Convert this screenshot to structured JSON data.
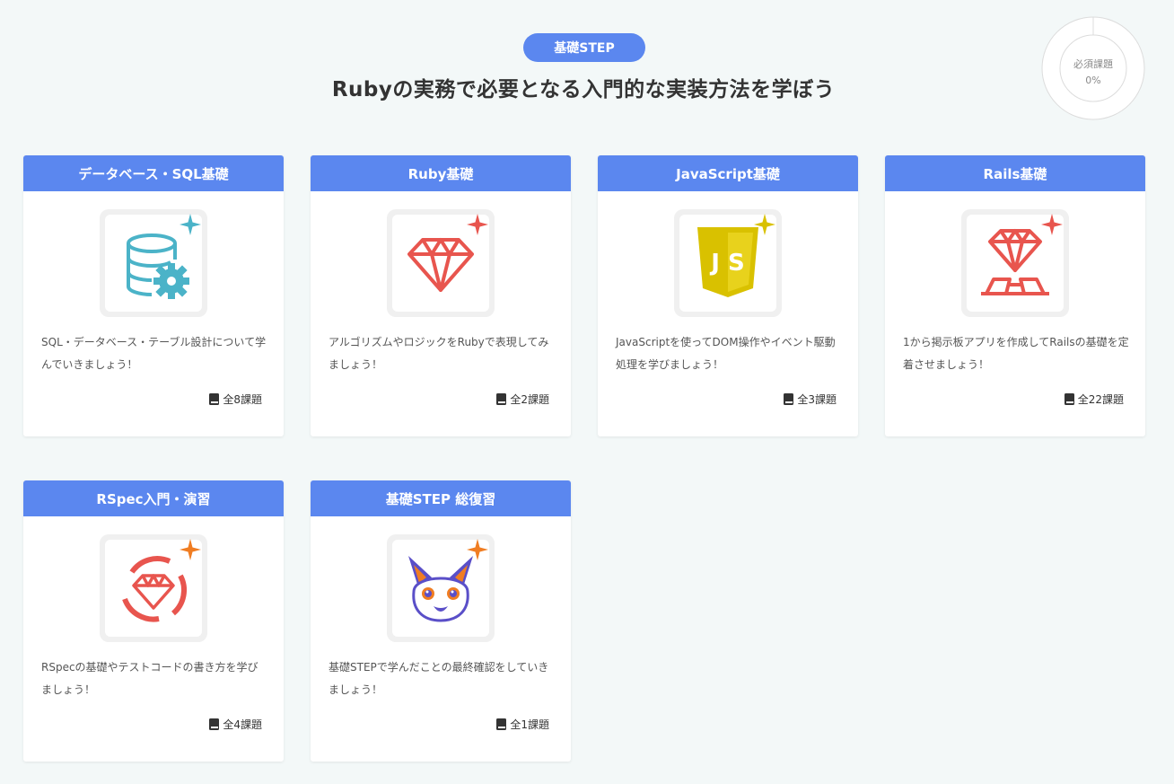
{
  "header": {
    "badge": "基礎STEP",
    "title": "Rubyの実務で必要となる入門的な実装方法を学ぼう"
  },
  "progress": {
    "label": "必須課題",
    "percent_text": "0%",
    "value": 0
  },
  "cards": [
    {
      "title": "データベース・SQL基礎",
      "icon": "database-gear-icon",
      "accent": "#4bb3c8",
      "desc": "SQL・データベース・テーブル設計について学んでいきましょう！",
      "count": "全8課題"
    },
    {
      "title": "Ruby基礎",
      "icon": "ruby-gem-icon",
      "accent": "#e8554e",
      "desc": "アルゴリズムやロジックをRubyで表現してみましょう！",
      "count": "全2課題"
    },
    {
      "title": "JavaScript基礎",
      "icon": "javascript-shield-icon",
      "accent": "#d9c100",
      "desc": "JavaScriptを使ってDOM操作やイベント駆動処理を学びましょう！",
      "count": "全3課題"
    },
    {
      "title": "Rails基礎",
      "icon": "rails-gem-icon",
      "accent": "#e8554e",
      "desc": "1から掲示板アプリを作成してRailsの基礎を定着させましょう！",
      "count": "全22課題"
    },
    {
      "title": "RSpec入門・演習",
      "icon": "rspec-cycle-gem-icon",
      "accent": "#e8554e",
      "desc": "RSpecの基礎やテストコードの書き方を学びましょう！",
      "count": "全4課題"
    },
    {
      "title": "基礎STEP 総復習",
      "icon": "fox-mascot-icon",
      "accent": "#f07d22",
      "desc": "基礎STEPで学んだことの最終確認をしていきましょう！",
      "count": "全1課題"
    }
  ]
}
